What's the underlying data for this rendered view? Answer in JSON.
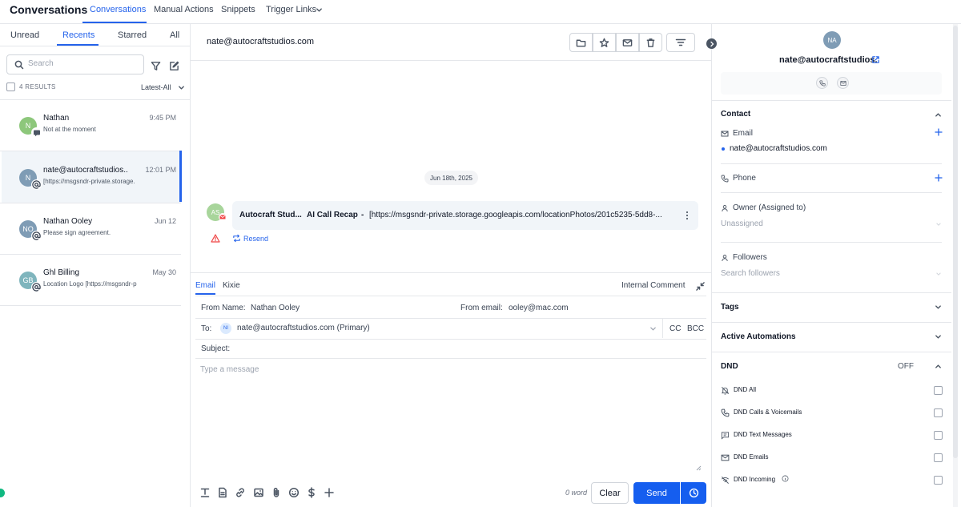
{
  "nav": {
    "title": "Conversations",
    "tabs": [
      "Conversations",
      "Manual Actions",
      "Snippets",
      "Trigger Links"
    ]
  },
  "filters": {
    "tabs": [
      "Unread",
      "Recents",
      "Starred",
      "All"
    ],
    "active": "Recents"
  },
  "search": {
    "placeholder": "Search"
  },
  "results": {
    "count": "4 RESULTS",
    "sort": "Latest-All"
  },
  "conversations": [
    {
      "initials": "N",
      "name": "Nathan",
      "time": "9:45 PM",
      "preview": "Not at the moment",
      "avatar_color": "#8dc77b"
    },
    {
      "initials": "N",
      "name": "nate@autocraftstudios..",
      "time": "12:01 PM",
      "preview": "[https://msgsndr-private.storage.",
      "avatar_color": "#7f9cb5"
    },
    {
      "initials": "NO",
      "name": "Nathan Ooley",
      "time": "Jun 12",
      "preview": "Please sign agreement.",
      "avatar_color": "#7f9cb5"
    },
    {
      "initials": "GB",
      "name": "Ghl Billing",
      "time": "May 30",
      "preview": "Location Logo [https://msgsndr-p",
      "avatar_color": "#7fb5bd"
    }
  ],
  "thread": {
    "contact": "nate@autocraftstudios.com",
    "date": "Jun 18th, 2025",
    "message": {
      "avatar": "AS",
      "sender": "Autocraft Stud...",
      "subject": "AI Call Recap",
      "separator": "-",
      "body": "[https://msgsndr-private.storage.googleapis.com/locationPhotos/201c5235-5dd8-..."
    },
    "resend": "Resend"
  },
  "composer": {
    "tabs": [
      "Email",
      "Kixie"
    ],
    "internal_comment": "Internal Comment",
    "from_name_label": "From Name:",
    "from_name": "Nathan Ooley",
    "from_email_label": "From email:",
    "from_email": "ooley@mac.com",
    "to_label": "To:",
    "to_initials": "NI",
    "to_value": "nate@autocraftstudios.com (Primary)",
    "cc": "CC",
    "bcc": "BCC",
    "subject_label": "Subject:",
    "message_placeholder": "Type a message",
    "word_count": "0 word",
    "clear": "Clear",
    "send": "Send"
  },
  "contact_panel": {
    "initials": "NA",
    "name": "nate@autocraftstudios.",
    "contact_title": "Contact",
    "email_label": "Email",
    "email_value": "nate@autocraftstudios.com",
    "phone_label": "Phone",
    "owner_label": "Owner (Assigned to)",
    "owner_value": "Unassigned",
    "followers_label": "Followers",
    "followers_placeholder": "Search followers",
    "tags_title": "Tags",
    "automations_title": "Active Automations",
    "dnd_title": "DND",
    "dnd_status": "OFF",
    "dnd_options": [
      "DND All",
      "DND Calls & Voicemails",
      "DND Text Messages",
      "DND Emails",
      "DND Incoming"
    ]
  },
  "colors": {
    "accent": "#2563eb",
    "send": "#155eef"
  }
}
